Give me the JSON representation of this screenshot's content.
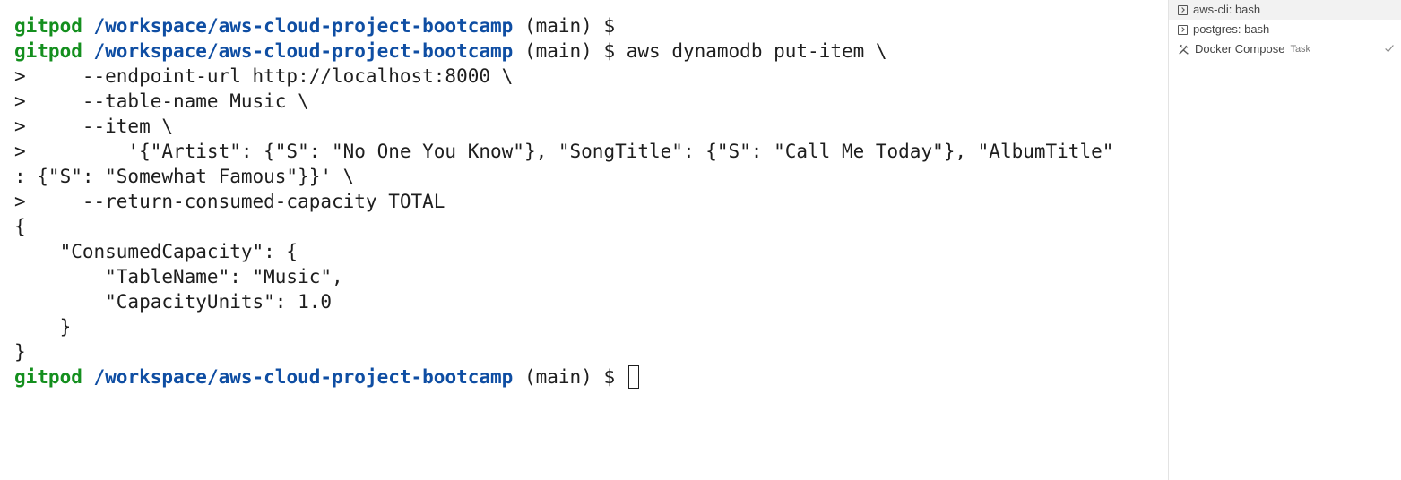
{
  "terminal": {
    "lines": [
      {
        "user": "gitpod",
        "path": "/workspace/aws-cloud-project-bootcamp",
        "rest": " (main) $"
      },
      {
        "user": "gitpod",
        "path": "/workspace/aws-cloud-project-bootcamp",
        "rest": " (main) $ aws dynamodb put-item \\"
      },
      {
        "text": ">     --endpoint-url http://localhost:8000 \\"
      },
      {
        "text": ">     --table-name Music \\"
      },
      {
        "text": ">     --item \\"
      },
      {
        "text": ">         '{\"Artist\": {\"S\": \"No One You Know\"}, \"SongTitle\": {\"S\": \"Call Me Today\"}, \"AlbumTitle\""
      },
      {
        "text": ": {\"S\": \"Somewhat Famous\"}}' \\"
      },
      {
        "text": ">     --return-consumed-capacity TOTAL"
      },
      {
        "text": "{"
      },
      {
        "text": "    \"ConsumedCapacity\": {"
      },
      {
        "text": "        \"TableName\": \"Music\","
      },
      {
        "text": "        \"CapacityUnits\": 1.0"
      },
      {
        "text": "    }"
      },
      {
        "text": "}"
      },
      {
        "user": "gitpod",
        "path": "/workspace/aws-cloud-project-bootcamp",
        "rest": " (main) $ "
      }
    ]
  },
  "sidebar": {
    "tabs": [
      {
        "label": "aws-cli: bash",
        "icon": "terminal-icon",
        "active": true
      },
      {
        "label": "postgres: bash",
        "icon": "terminal-icon",
        "active": false
      },
      {
        "label": "Docker Compose",
        "sub": "Task",
        "icon": "tools-icon",
        "status_icon": "check-icon",
        "active": false
      }
    ]
  },
  "colors": {
    "user": "#148f1e",
    "path": "#0f4ea3",
    "text": "#1e1e1e"
  }
}
